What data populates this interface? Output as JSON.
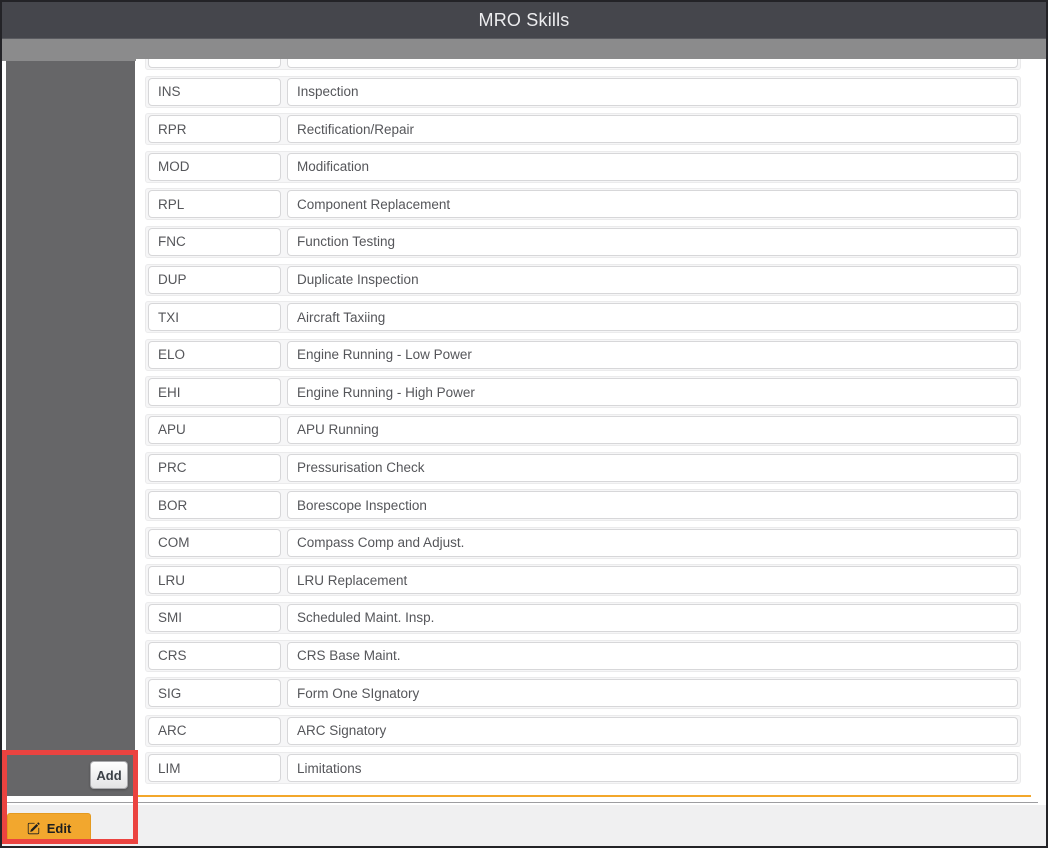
{
  "header": {
    "title": "MRO Skills"
  },
  "sidebar": {
    "add_label": "Add"
  },
  "footer": {
    "edit_label": "Edit"
  },
  "icons": {
    "edit_button_icon": "pencil-square-icon"
  },
  "colors": {
    "titlebar_bg": "#45464C",
    "toolbar_strip_bg": "#8B8B8C",
    "sidebar_bg": "#666668",
    "accent_orange": "#F2A72E",
    "annotation_red": "#EB4340",
    "footer_bg": "#F0F0F1"
  },
  "skills": {
    "columns": [
      "code",
      "description"
    ],
    "rows": [
      {
        "code": "",
        "description": ""
      },
      {
        "code": "INS",
        "description": "Inspection"
      },
      {
        "code": "RPR",
        "description": "Rectification/Repair"
      },
      {
        "code": "MOD",
        "description": "Modification"
      },
      {
        "code": "RPL",
        "description": "Component Replacement"
      },
      {
        "code": "FNC",
        "description": "Function Testing"
      },
      {
        "code": "DUP",
        "description": "Duplicate Inspection"
      },
      {
        "code": "TXI",
        "description": "Aircraft Taxiing"
      },
      {
        "code": "ELO",
        "description": "Engine Running - Low Power"
      },
      {
        "code": "EHI",
        "description": "Engine Running - High Power"
      },
      {
        "code": "APU",
        "description": "APU Running"
      },
      {
        "code": "PRC",
        "description": "Pressurisation Check"
      },
      {
        "code": "BOR",
        "description": "Borescope Inspection"
      },
      {
        "code": "COM",
        "description": "Compass Comp and Adjust."
      },
      {
        "code": "LRU",
        "description": "LRU Replacement"
      },
      {
        "code": "SMI",
        "description": "Scheduled Maint. Insp."
      },
      {
        "code": "CRS",
        "description": "CRS Base Maint."
      },
      {
        "code": "SIG",
        "description": "Form One SIgnatory"
      },
      {
        "code": "ARC",
        "description": "ARC Signatory"
      },
      {
        "code": "LIM",
        "description": "Limitations"
      }
    ]
  }
}
